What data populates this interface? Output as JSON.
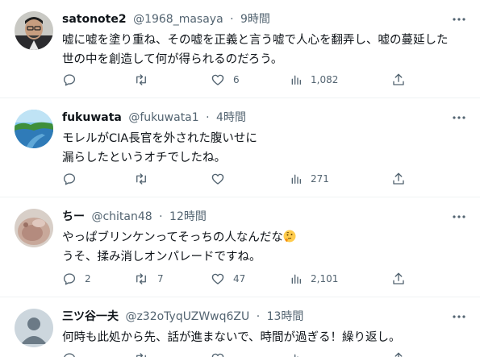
{
  "tweets": [
    {
      "name": "satonote2",
      "handle": "@1968_masaya",
      "time": "9時間",
      "lines": [
        "嘘に嘘を塗り重ね、その嘘を正義と言う嘘で人心を翻弄し、嘘の蔓延した",
        "世の中を創造して何が得られるのだろう。"
      ],
      "reply_count": "",
      "retweet_count": "",
      "like_count": "6",
      "view_count": "1,082"
    },
    {
      "name": "fukuwata",
      "handle": "@fukuwata1",
      "time": "4時間",
      "lines": [
        "モレルがCIA長官を外された腹いせに",
        "漏らしたというオチでしたね。"
      ],
      "reply_count": "",
      "retweet_count": "",
      "like_count": "",
      "view_count": "271"
    },
    {
      "name": "ちー",
      "handle": "@chitan48",
      "time": "12時間",
      "lines": [
        "やっぱブリンケンってそっちの人なんだな",
        "うそ、揉み消しオンパレードですね。"
      ],
      "reply_count": "2",
      "retweet_count": "7",
      "like_count": "47",
      "view_count": "2,101"
    },
    {
      "name": "三ツ谷一夫",
      "handle": "@z32oTyqUZWwq6ZU",
      "time": "13時間",
      "lines": [
        "何時も此処から先、話が進まないで、時間が過ぎる！繰り返し。"
      ],
      "reply_count": "",
      "retweet_count": "",
      "like_count": "",
      "view_count": ""
    }
  ],
  "separator": "·",
  "icons": {
    "reply": "reply-icon",
    "retweet": "retweet-icon",
    "like": "heart-icon",
    "views": "views-icon",
    "share": "share-icon",
    "more": "more-icon",
    "emoji": "thinking-face-emoji"
  },
  "colors": {
    "text": "#0f1419",
    "secondary": "#536471",
    "divider": "#eff3f4"
  }
}
